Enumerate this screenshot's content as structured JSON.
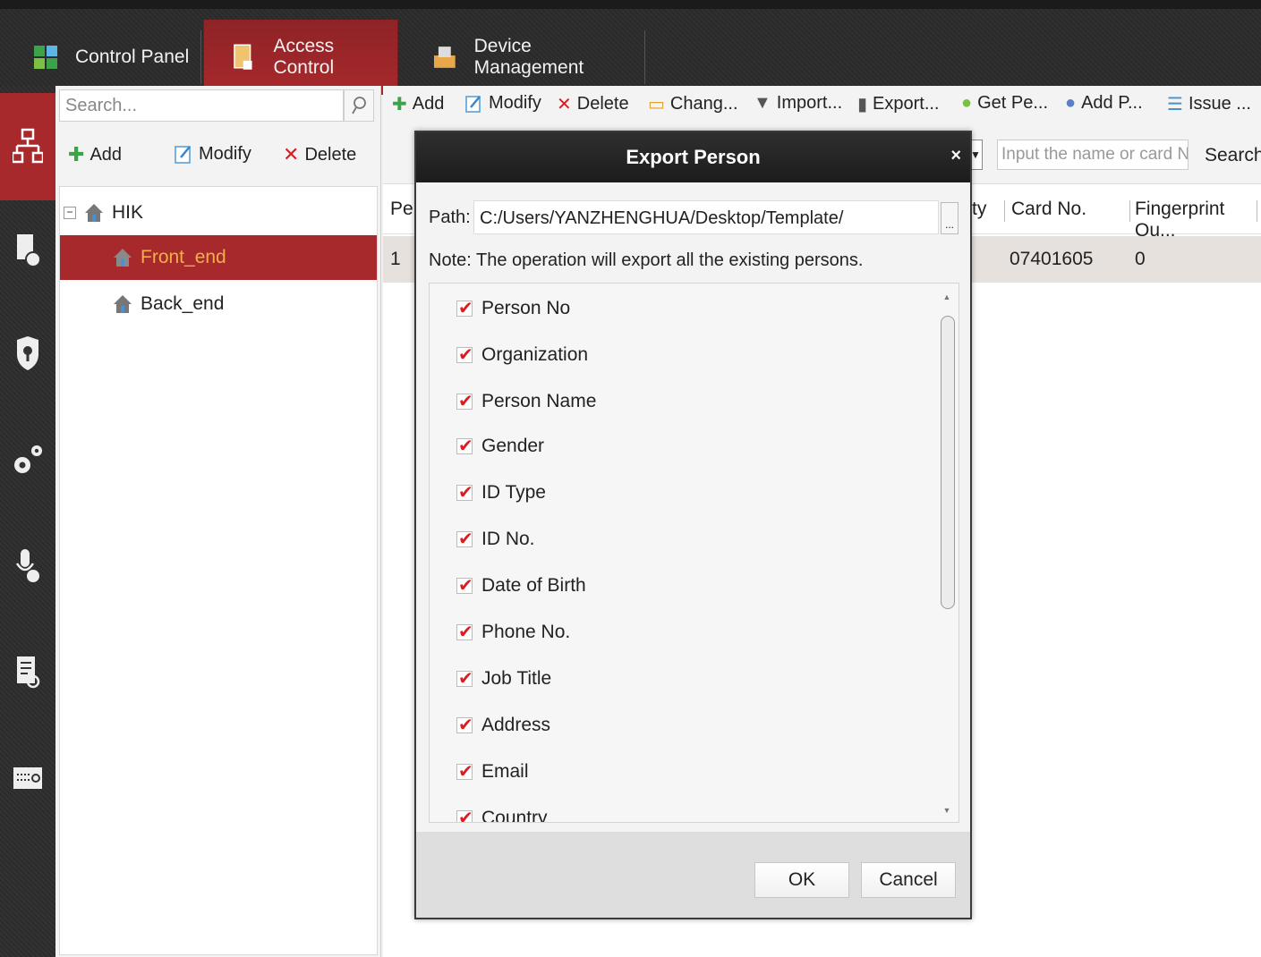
{
  "tabs": [
    {
      "label": "Control Panel",
      "icon": "control-panel-icon"
    },
    {
      "label": "Access Control",
      "icon": "access-control-icon",
      "active": true
    },
    {
      "label": "Device Management",
      "icon": "device-management-icon"
    }
  ],
  "left_rail": [
    "organization-icon",
    "person-card-icon",
    "location-shield-icon",
    "settings-gears-icon",
    "voice-icon",
    "report-search-icon",
    "device-terminal-icon"
  ],
  "tree_panel": {
    "search_placeholder": "Search...",
    "add_label": "Add",
    "modify_label": "Modify",
    "delete_label": "Delete",
    "root": "HIK",
    "nodes": [
      "Front_end",
      "Back_end"
    ]
  },
  "main_toolbar": {
    "add": "Add",
    "modify": "Modify",
    "delete": "Delete",
    "change": "Chang...",
    "import": "Import...",
    "export": "Export...",
    "get_person": "Get Pe...",
    "add_person": "Add P...",
    "issue": "Issue ..."
  },
  "filter": {
    "placeholder": "Input the name or card No...",
    "search_label": "Search"
  },
  "table": {
    "headers": {
      "col1": "Per",
      "col_ty": "ty",
      "card_no": "Card No.",
      "fingerprint": "Fingerprint Qu..."
    },
    "rows": [
      {
        "index": "1",
        "card_no": "07401605",
        "fingerprint": "0"
      }
    ]
  },
  "dialog": {
    "title": "Export Person",
    "close": "×",
    "path_label": "Path:",
    "path_value": "C:/Users/YANZHENGHUA/Desktop/Template/",
    "browse": "...",
    "note": "Note: The operation will export all the existing persons.",
    "fields": [
      "Person No",
      "Organization",
      "Person Name",
      "Gender",
      "ID Type",
      "ID No.",
      "Date of Birth",
      "Phone No.",
      "Job Title",
      "Address",
      "Email",
      "Country"
    ],
    "ok": "OK",
    "cancel": "Cancel"
  },
  "colors": {
    "accent_red": "#a8292c",
    "check_red": "#d61f24",
    "selected_text": "#f0b04a"
  }
}
